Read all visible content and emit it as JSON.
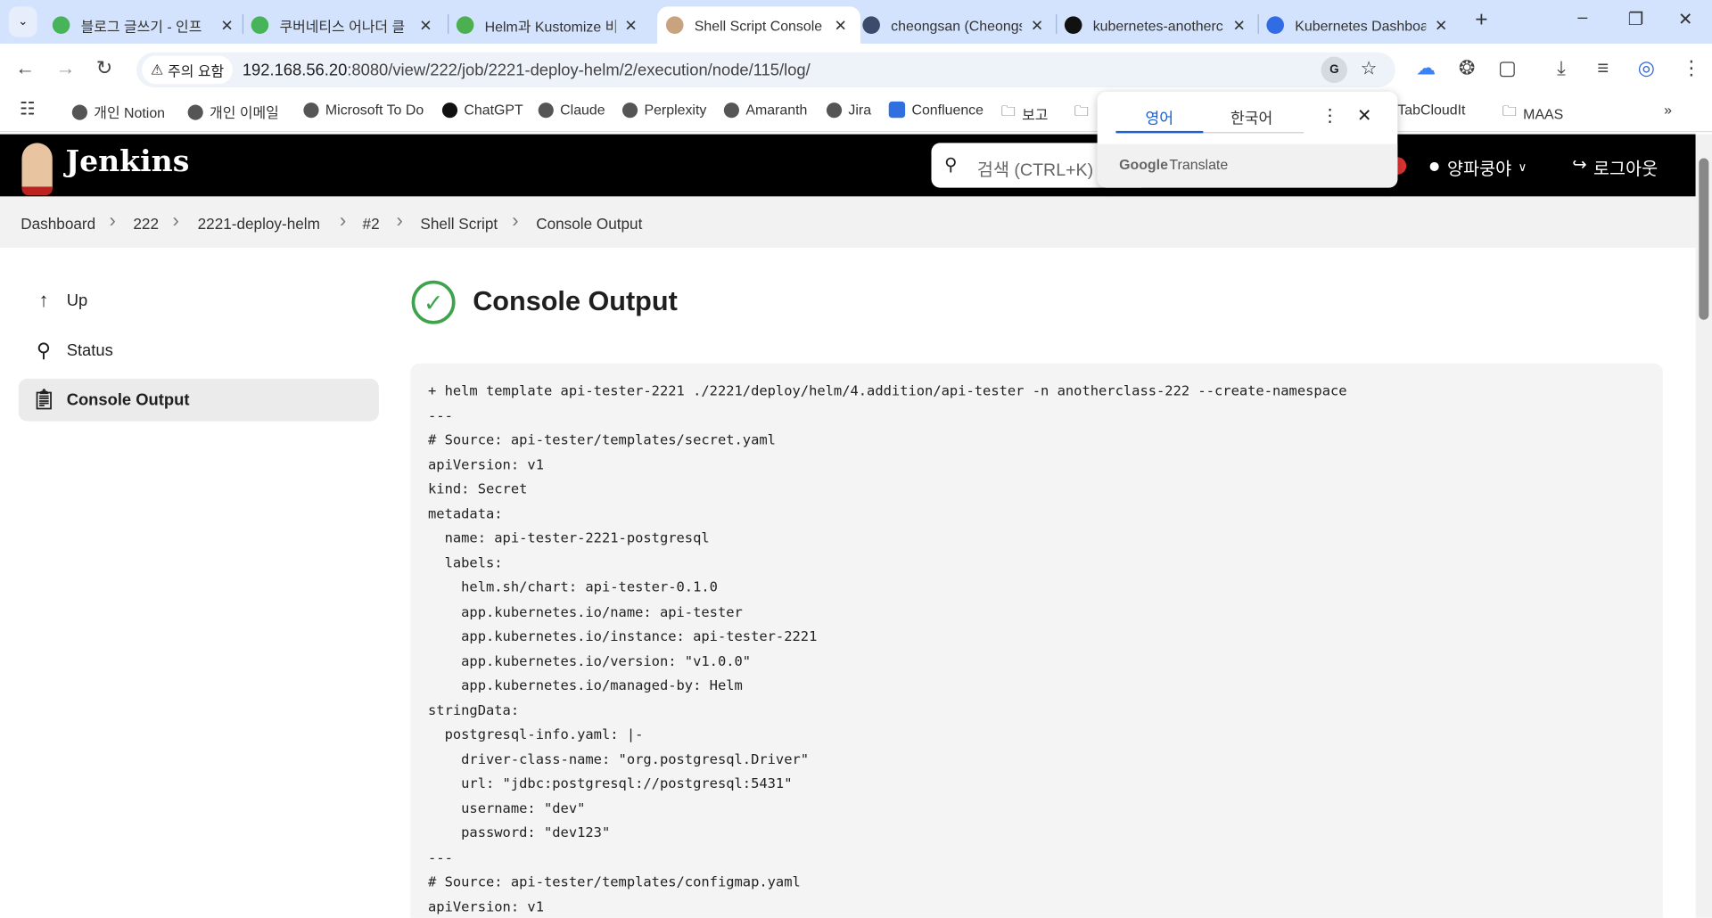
{
  "browser": {
    "tabs": [
      {
        "title": "블로그 글쓰기 - 인프",
        "active": false,
        "icon": "inflearn-icon",
        "color": "#48b45a"
      },
      {
        "title": "쿠버네티스 어나더 클",
        "active": false,
        "icon": "inflearn-icon",
        "color": "#48b45a"
      },
      {
        "title": "Helm과 Kustomize 비",
        "active": false,
        "icon": "teacup-icon",
        "color": "#4caf50"
      },
      {
        "title": "Shell Script Console",
        "active": true,
        "icon": "jenkins-icon",
        "color": "#c9a27e"
      },
      {
        "title": "cheongsan (Cheongs",
        "active": false,
        "icon": "docker-icon",
        "color": "#3b4b6b"
      },
      {
        "title": "kubernetes-anotherc",
        "active": false,
        "icon": "github-icon",
        "color": "#111111"
      },
      {
        "title": "Kubernetes Dashboa",
        "active": false,
        "icon": "kubernetes-icon",
        "color": "#326ce5"
      }
    ],
    "security_label": "주의 요함",
    "url_host": "192.168.56.20",
    "url_rest": ":8080/view/222/job/2221-deploy-helm/2/execution/node/115/log/",
    "bookmarks": [
      "개인 Notion",
      "개인 이메일",
      "Microsoft To Do",
      "ChatGPT",
      "Claude",
      "Perplexity",
      "Amaranth",
      "Jira",
      "Confluence",
      "보고"
    ],
    "bookmarks_right": [
      "TabCloudIt",
      "MAAS"
    ]
  },
  "translate": {
    "lang_from": "영어",
    "lang_to": "한국어",
    "brand": "Google",
    "product": "Translate"
  },
  "jenkins": {
    "logo": "Jenkins",
    "search_placeholder": "검색 (CTRL+K)",
    "user": "양파쿵야",
    "logout": "로그아웃",
    "breadcrumbs": [
      "Dashboard",
      "222",
      "2221-deploy-helm",
      "#2",
      "Shell Script",
      "Console Output"
    ],
    "sidebar": [
      {
        "label": "Up"
      },
      {
        "label": "Status"
      },
      {
        "label": "Console Output"
      }
    ],
    "page_title": "Console Output",
    "success_color": "#3fa34d",
    "console_lines": [
      "+ helm template api-tester-2221 ./2221/deploy/helm/4.addition/api-tester -n anotherclass-222 --create-namespace",
      "---",
      "# Source: api-tester/templates/secret.yaml",
      "apiVersion: v1",
      "kind: Secret",
      "metadata:",
      "  name: api-tester-2221-postgresql",
      "  labels:",
      "    helm.sh/chart: api-tester-0.1.0",
      "    app.kubernetes.io/name: api-tester",
      "    app.kubernetes.io/instance: api-tester-2221",
      "    app.kubernetes.io/version: \"v1.0.0\"",
      "    app.kubernetes.io/managed-by: Helm",
      "stringData:",
      "  postgresql-info.yaml: |-",
      "    driver-class-name: \"org.postgresql.Driver\"",
      "    url: \"jdbc:postgresql://postgresql:5431\"",
      "    username: \"dev\"",
      "    password: \"dev123\"",
      "---",
      "# Source: api-tester/templates/configmap.yaml",
      "apiVersion: v1"
    ]
  }
}
